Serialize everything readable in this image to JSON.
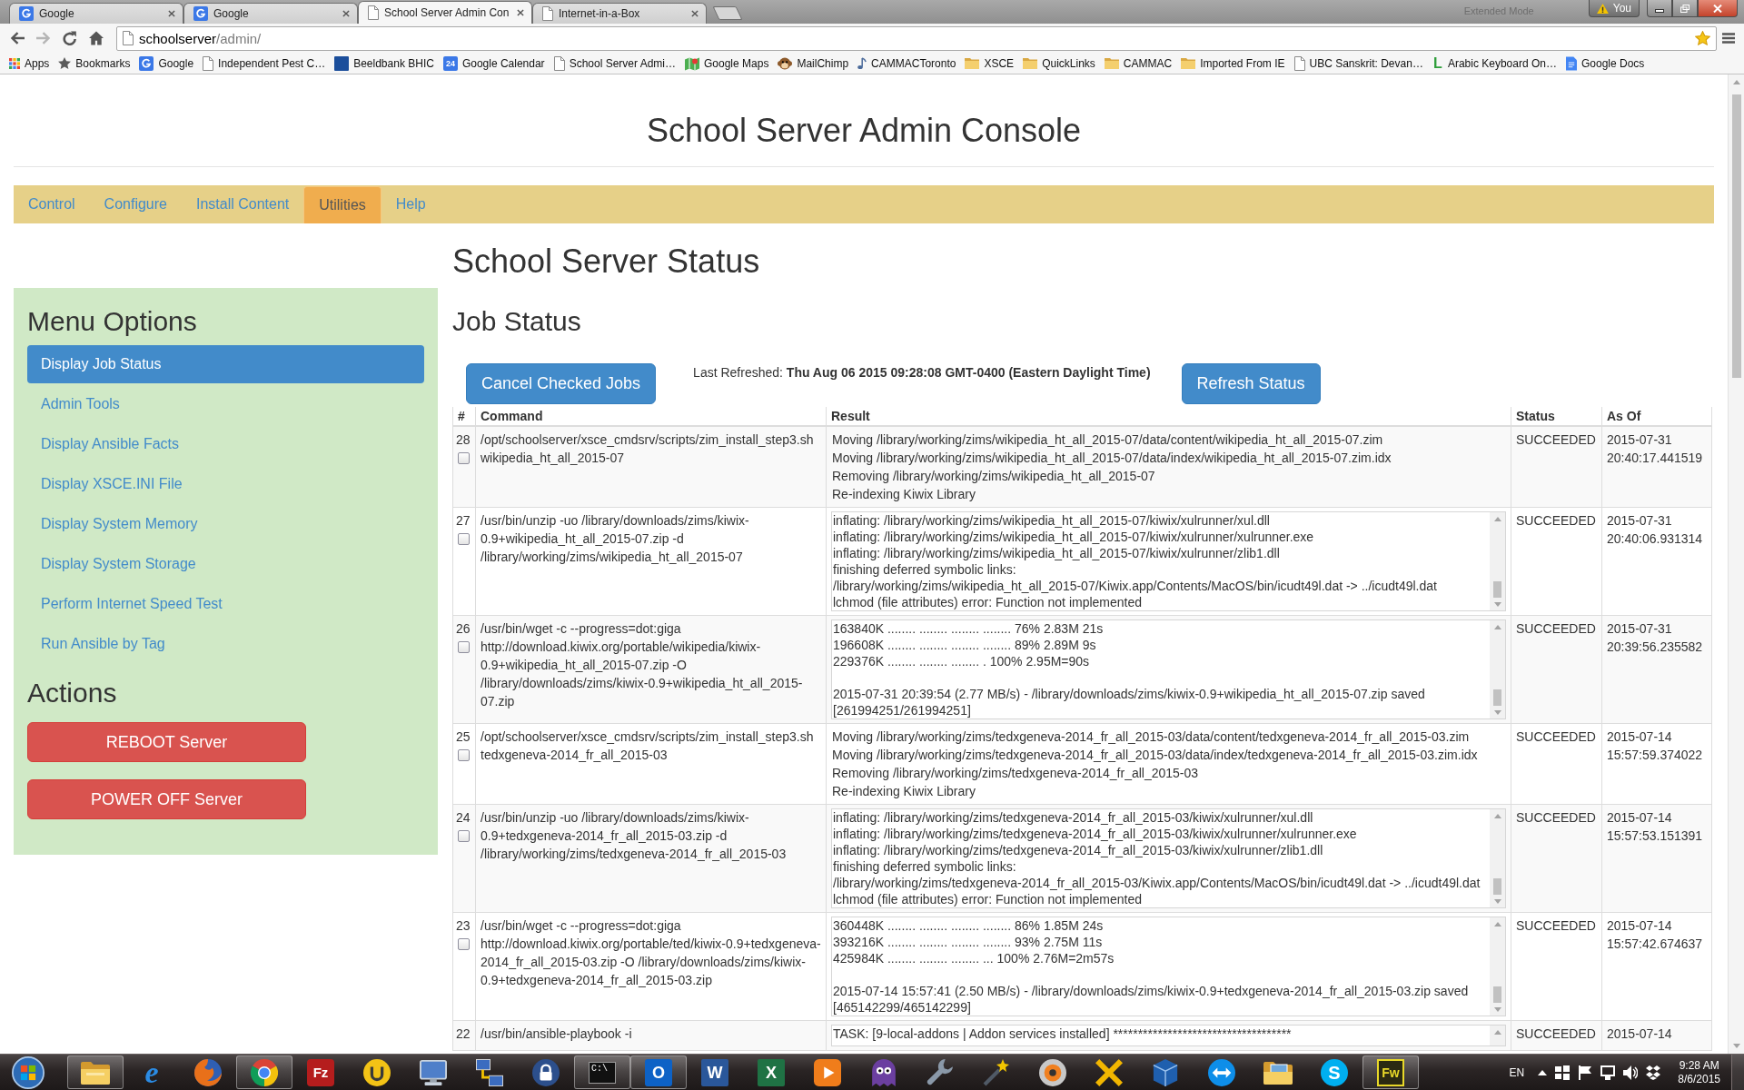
{
  "browser": {
    "tabs": [
      {
        "title": "Google",
        "kind": "tile",
        "selected": false
      },
      {
        "title": "Google",
        "kind": "tile",
        "selected": false
      },
      {
        "title": "School Server Admin Con",
        "kind": "page",
        "selected": true
      },
      {
        "title": "Internet-in-a-Box",
        "kind": "page",
        "selected": false
      }
    ],
    "title_bar_text": "Extended Mode",
    "profile": "You",
    "toolbar": {
      "back_disabled": false,
      "forward_disabled": true
    },
    "url": {
      "host": "schoolserver",
      "path": "/admin/"
    },
    "bookmarked": true,
    "bookmarks": [
      {
        "label": "Apps",
        "kind": "apps"
      },
      {
        "label": "Bookmarks",
        "kind": "star"
      },
      {
        "label": "Google",
        "kind": "tile"
      },
      {
        "label": "Independent Pest C…",
        "kind": "page"
      },
      {
        "label": "Beeldbank BHIC",
        "kind": "square"
      },
      {
        "label": "Google Calendar",
        "kind": "calendar",
        "glyph": "24"
      },
      {
        "label": "School Server Admi…",
        "kind": "page"
      },
      {
        "label": "Google Maps",
        "kind": "map"
      },
      {
        "label": "MailChimp",
        "kind": "monkey"
      },
      {
        "label": "CAMMACToronto",
        "kind": "note"
      },
      {
        "label": "XSCE",
        "kind": "folder"
      },
      {
        "label": "QuickLinks",
        "kind": "folder"
      },
      {
        "label": "CAMMAC",
        "kind": "folder"
      },
      {
        "label": "Imported From IE",
        "kind": "folder"
      },
      {
        "label": "UBC Sanskrit: Devan…",
        "kind": "page"
      },
      {
        "label": "Arabic Keyboard On…",
        "kind": "letter",
        "glyph": "L"
      },
      {
        "label": "Google Docs",
        "kind": "docs"
      }
    ]
  },
  "page": {
    "title": "School Server Admin Console",
    "nav": [
      {
        "label": "Control",
        "selected": false
      },
      {
        "label": "Configure",
        "selected": false
      },
      {
        "label": "Install Content",
        "selected": false
      },
      {
        "label": "Utilities",
        "selected": true
      },
      {
        "label": "Help",
        "selected": false
      }
    ],
    "sidebar": {
      "heading": "Menu Options",
      "items": [
        {
          "label": "Display Job Status",
          "selected": true
        },
        {
          "label": "Admin Tools",
          "selected": false
        },
        {
          "label": "Display Ansible Facts",
          "selected": false
        },
        {
          "label": "Display XSCE.INI File",
          "selected": false
        },
        {
          "label": "Display System Memory",
          "selected": false
        },
        {
          "label": "Display System Storage",
          "selected": false
        },
        {
          "label": "Perform Internet Speed Test",
          "selected": false
        },
        {
          "label": "Run Ansible by Tag",
          "selected": false
        }
      ],
      "actions_heading": "Actions",
      "actions": [
        "REBOOT Server",
        "POWER OFF Server"
      ]
    },
    "main": {
      "title": "School Server Status",
      "subtitle": "Job Status",
      "cancel_button": "Cancel Checked Jobs",
      "last_refreshed": "Last Refreshed: **Thu Aug 06 2015 09:28:08 GMT-0400 (Eastern Daylight Time)**",
      "refresh_button": "Refresh Status",
      "table": {
        "columns": [
          "#",
          "Command",
          "Result",
          "Status",
          "As Of"
        ],
        "rows": [
          {
            "number": "28",
            "checked": false,
            "command": "/opt/schoolserver/xsce_cmdsrv/scripts/zim_install_step3.sh wikipedia_ht_all_2015-07",
            "kind": "plain",
            "result": [
              [
                "Moving /library/working/zims/wikipedia_ht_all_2015-07/data/content/wikipedia_ht_all_2015-07.zim",
                "Moving /library/working/zims/wikipedia_ht_all_2015-07/data/index/wikipedia_ht_all_2015-07.zim.idx",
                "Removing /library/working/zims/wikipedia_ht_all_2015-07",
                "Re-indexing Kiwix Library"
              ]
            ],
            "status": "SUCCEEDED",
            "as_of": "2015-07-31 20:40:17.441519"
          },
          {
            "number": "27",
            "checked": false,
            "command": "/usr/bin/unzip -uo /library/downloads/zims/kiwix-0.9+wikipedia_ht_all_2015-07.zip -d /library/working/zims/wikipedia_ht_all_2015-07",
            "kind": "scroll",
            "result": [
              [
                "inflating: /library/working/zims/wikipedia_ht_all_2015-07/kiwix/xulrunner/xul.dll",
                "inflating: /library/working/zims/wikipedia_ht_all_2015-07/kiwix/xulrunner/xulrunner.exe",
                "inflating: /library/working/zims/wikipedia_ht_all_2015-07/kiwix/xulrunner/zlib1.dll",
                "finishing deferred symbolic links:",
                "/library/working/zims/wikipedia_ht_all_2015-07/Kiwix.app/Contents/MacOS/bin/icudt49l.dat -> ../icudt49l.dat",
                "lchmod (file attributes) error: Function not implemented"
              ]
            ],
            "status": "SUCCEEDED",
            "as_of": "2015-07-31 20:40:06.931314"
          },
          {
            "number": "26",
            "checked": false,
            "command": "/usr/bin/wget -c --progress=dot:giga http://download.kiwix.org/portable/wikipedia/kiwix-0.9+wikipedia_ht_all_2015-07.zip -O /library/downloads/zims/kiwix-0.9+wikipedia_ht_all_2015-07.zip",
            "kind": "scroll",
            "result": [
              [
                "163840K ........ ........ ........ ........ 76% 2.83M 21s",
                "196608K ........ ........ ........ ........ 89% 2.89M 9s",
                "229376K ........ ........ ........ . 100% 2.95M=90s"
              ],
              [
                "2015-07-31 20:39:54 (2.77 MB/s) - /library/downloads/zims/kiwix-0.9+wikipedia_ht_all_2015-07.zip saved [261994251/261994251]"
              ]
            ],
            "status": "SUCCEEDED",
            "as_of": "2015-07-31 20:39:56.235582"
          },
          {
            "number": "25",
            "checked": false,
            "command": "/opt/schoolserver/xsce_cmdsrv/scripts/zim_install_step3.sh tedxgeneva-2014_fr_all_2015-03",
            "kind": "plain",
            "result": [
              [
                "Moving /library/working/zims/tedxgeneva-2014_fr_all_2015-03/data/content/tedxgeneva-2014_fr_all_2015-03.zim",
                "Moving /library/working/zims/tedxgeneva-2014_fr_all_2015-03/data/index/tedxgeneva-2014_fr_all_2015-03.zim.idx",
                "Removing /library/working/zims/tedxgeneva-2014_fr_all_2015-03",
                "Re-indexing Kiwix Library"
              ]
            ],
            "status": "SUCCEEDED",
            "as_of": "2015-07-14 15:57:59.374022"
          },
          {
            "number": "24",
            "checked": false,
            "command": "/usr/bin/unzip -uo /library/downloads/zims/kiwix-0.9+tedxgeneva-2014_fr_all_2015-03.zip -d /library/working/zims/tedxgeneva-2014_fr_all_2015-03",
            "kind": "scroll",
            "result": [
              [
                "inflating: /library/working/zims/tedxgeneva-2014_fr_all_2015-03/kiwix/xulrunner/xul.dll",
                "inflating: /library/working/zims/tedxgeneva-2014_fr_all_2015-03/kiwix/xulrunner/xulrunner.exe",
                "inflating: /library/working/zims/tedxgeneva-2014_fr_all_2015-03/kiwix/xulrunner/zlib1.dll",
                "finishing deferred symbolic links:",
                "/library/working/zims/tedxgeneva-2014_fr_all_2015-03/Kiwix.app/Contents/MacOS/bin/icudt49l.dat -> ../icudt49l.dat",
                "lchmod (file attributes) error: Function not implemented"
              ]
            ],
            "status": "SUCCEEDED",
            "as_of": "2015-07-14 15:57:53.151391"
          },
          {
            "number": "23",
            "checked": false,
            "command": "/usr/bin/wget -c --progress=dot:giga http://download.kiwix.org/portable/ted/kiwix-0.9+tedxgeneva-2014_fr_all_2015-03.zip -O /library/downloads/zims/kiwix-0.9+tedxgeneva-2014_fr_all_2015-03.zip",
            "kind": "scroll",
            "result": [
              [
                "360448K ........ ........ ........ ........ 86% 1.85M 24s",
                "393216K ........ ........ ........ ........ 93% 2.75M 11s",
                "425984K ........ ........ ........ ... 100% 2.76M=2m57s"
              ],
              [
                "2015-07-14 15:57:41 (2.50 MB/s) - /library/downloads/zims/kiwix-0.9+tedxgeneva-2014_fr_all_2015-03.zip saved [465142299/465142299]"
              ]
            ],
            "status": "SUCCEEDED",
            "as_of": "2015-07-14 15:57:42.674637"
          },
          {
            "number": "22",
            "command": "/usr/bin/ansible-playbook -i",
            "kind": "scroll-cut",
            "result": [
              [
                "TASK: [9-local-addons | Addon services installed] ************************************"
              ]
            ],
            "status": "SUCCEEDED",
            "as_of": "2015-07-14"
          }
        ]
      }
    }
  },
  "taskbar": {
    "apps": [
      {
        "kind": "folder",
        "running": true
      },
      {
        "kind": "letter-e",
        "glyph": "e",
        "running": false
      },
      {
        "kind": "globe",
        "running": false
      },
      {
        "kind": "segmented-circle",
        "running": true
      },
      {
        "kind": "fz",
        "glyph": "Fz",
        "running": false
      },
      {
        "kind": "yellow-circle",
        "running": false
      },
      {
        "kind": "monitor",
        "running": false
      },
      {
        "kind": "network",
        "running": false
      },
      {
        "kind": "padlock",
        "running": false
      },
      {
        "kind": "terminal",
        "glyph": "C:\\",
        "running": true
      },
      {
        "kind": "outlook",
        "glyph": "O",
        "running": true
      },
      {
        "kind": "word",
        "glyph": "W",
        "running": false
      },
      {
        "kind": "excel",
        "glyph": "X",
        "running": false
      },
      {
        "kind": "play",
        "running": false
      },
      {
        "kind": "ghost",
        "running": false
      },
      {
        "kind": "wrench",
        "running": false
      },
      {
        "kind": "wand",
        "running": false
      },
      {
        "kind": "disc",
        "running": false
      },
      {
        "kind": "x-mark",
        "running": false
      },
      {
        "kind": "cube",
        "running": false
      },
      {
        "kind": "double-arrow",
        "running": false
      },
      {
        "kind": "photo-folder",
        "running": false
      },
      {
        "kind": "skype",
        "glyph": "S",
        "running": false
      },
      {
        "kind": "fw",
        "glyph": "Fw",
        "running": true
      }
    ],
    "language": "EN",
    "time": "9:28 AM",
    "date": "8/6/2015"
  }
}
